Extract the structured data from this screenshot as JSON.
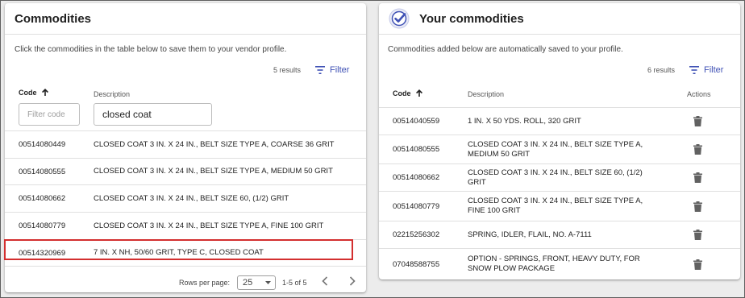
{
  "left": {
    "title": "Commodities",
    "instruction": "Click the commodities in the table below to save them to your vendor profile.",
    "results": "5 results",
    "filter_label": "Filter",
    "columns": {
      "code": "Code",
      "description": "Description"
    },
    "code_filter_placeholder": "Filter code",
    "description_filter_value": "closed coat",
    "rows": [
      {
        "code": "00514080449",
        "description": "CLOSED COAT 3 IN. X 24 IN., BELT SIZE TYPE A, COARSE 36 GRIT"
      },
      {
        "code": "00514080555",
        "description": "CLOSED COAT 3 IN. X 24 IN., BELT SIZE TYPE A, MEDIUM 50 GRIT"
      },
      {
        "code": "00514080662",
        "description": "CLOSED COAT 3 IN. X 24 IN., BELT SIZE 60, (1/2) GRIT"
      },
      {
        "code": "00514080779",
        "description": "CLOSED COAT 3 IN. X 24 IN., BELT SIZE TYPE A, FINE 100 GRIT"
      },
      {
        "code": "00514320969",
        "description": "7 IN. X NH, 50/60 GRIT, TYPE C, CLOSED COAT"
      }
    ],
    "pager": {
      "rows_per_page_label": "Rows per page:",
      "rows_per_page": "25",
      "range": "1-5 of 5"
    }
  },
  "right": {
    "title": "Your commodities",
    "instruction": "Commodities added below are automatically saved to your profile.",
    "results": "6 results",
    "filter_label": "Filter",
    "columns": {
      "code": "Code",
      "description": "Description",
      "actions": "Actions"
    },
    "rows": [
      {
        "code": "00514040559",
        "description": "1 IN. X 50 YDS. ROLL, 320 GRIT"
      },
      {
        "code": "00514080555",
        "description": "CLOSED COAT 3 IN. X 24 IN., BELT SIZE TYPE A, MEDIUM 50 GRIT"
      },
      {
        "code": "00514080662",
        "description": "CLOSED COAT 3 IN. X 24 IN., BELT SIZE 60, (1/2) GRIT"
      },
      {
        "code": "00514080779",
        "description": "CLOSED COAT 3 IN. X 24 IN., BELT SIZE TYPE A, FINE 100 GRIT"
      },
      {
        "code": "02215256302",
        "description": "SPRING, IDLER, FLAIL, NO. A-7111"
      },
      {
        "code": "07048588755",
        "description": "OPTION - SPRINGS, FRONT, HEAVY DUTY, FOR SNOW PLOW PACKAGE"
      }
    ]
  },
  "colors": {
    "accent": "#3f51b5",
    "highlight": "#d32f2f",
    "trash": "#616161"
  },
  "icons": {
    "check": "check-circle-icon",
    "filter": "filter-icon",
    "sort": "arrow-up-icon",
    "delete": "trash-icon"
  }
}
